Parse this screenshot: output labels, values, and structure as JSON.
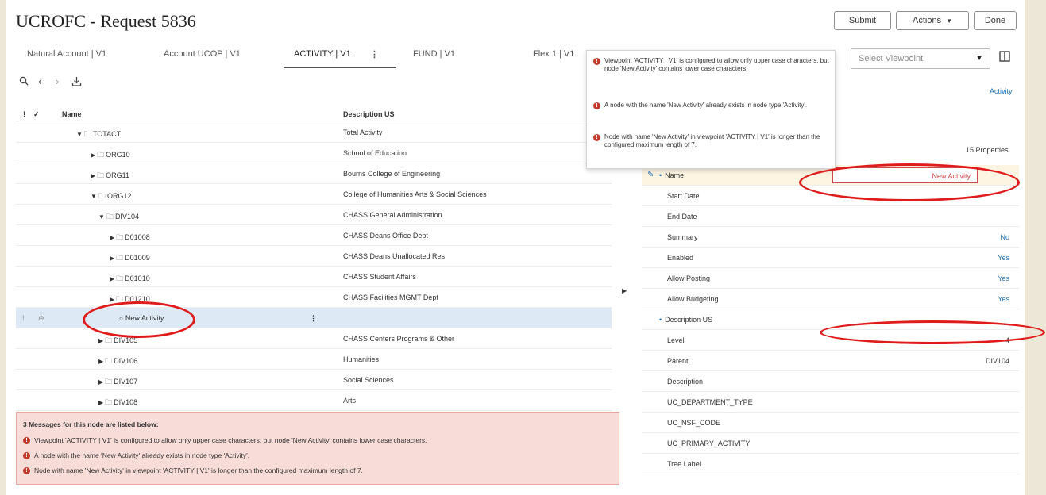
{
  "header": {
    "title": "UCROFC - Request 5836",
    "submit_label": "Submit",
    "actions_label": "Actions",
    "done_label": "Done"
  },
  "tabs": [
    {
      "label": "Natural Account | V1"
    },
    {
      "label": "Account UCOP | V1"
    },
    {
      "label": "ACTIVITY | V1"
    },
    {
      "label": "FUND | V1"
    },
    {
      "label": "Flex 1 | V1"
    }
  ],
  "tree": {
    "columns": {
      "flags": "!",
      "check": "✓",
      "name": "Name",
      "description": "Description US"
    },
    "rows": [
      {
        "name": "TOTACT",
        "description": "Total Activity"
      },
      {
        "name": "ORG10",
        "description": "School of Education"
      },
      {
        "name": "ORG11",
        "description": "Bourns College of Engineering"
      },
      {
        "name": "ORG12",
        "description": "College of Humanities Arts & Social Sciences"
      },
      {
        "name": "DIV104",
        "description": "CHASS General Administration"
      },
      {
        "name": "D01008",
        "description": "CHASS Deans Office Dept"
      },
      {
        "name": "D01009",
        "description": "CHASS Deans Unallocated Res"
      },
      {
        "name": "D01010",
        "description": "CHASS Student Affairs"
      },
      {
        "name": "D01210",
        "description": "CHASS Facilities MGMT Dept"
      },
      {
        "name": "New Activity",
        "description": "",
        "flag": "!"
      },
      {
        "name": "DIV105",
        "description": "CHASS Centers Programs & Other"
      },
      {
        "name": "DIV106",
        "description": "Humanities"
      },
      {
        "name": "DIV107",
        "description": "Social Sciences"
      },
      {
        "name": "DIV108",
        "description": "Arts"
      }
    ]
  },
  "messages": {
    "title": "3 Messages for this node are listed below:",
    "items": [
      "Viewpoint 'ACTIVITY | V1' is configured to allow only upper case characters, but node 'New Activity' contains lower case characters.",
      "A node with the name 'New Activity' already exists in node type 'Activity'.",
      "Node with name 'New Activity' in viewpoint 'ACTIVITY | V1' is longer than the configured maximum length of 7."
    ]
  },
  "tooltip": {
    "items": [
      "Viewpoint 'ACTIVITY | V1' is configured to allow only upper case characters, but node 'New Activity' contains lower case characters.",
      "A node with the name 'New Activity' already exists in node type 'Activity'.",
      "Node with name 'New Activity' in viewpoint 'ACTIVITY | V1' is longer than the configured maximum length of 7."
    ]
  },
  "viewpoint": {
    "placeholder": "Select Viewpoint"
  },
  "properties": {
    "node_type_link": "Activity",
    "count": "15 Properties",
    "name_label": "Name",
    "name_value": "New Activity",
    "rows": [
      {
        "label": "Start Date",
        "value": ""
      },
      {
        "label": "End Date",
        "value": ""
      },
      {
        "label": "Summary",
        "value": "No"
      },
      {
        "label": "Enabled",
        "value": "Yes"
      },
      {
        "label": "Allow Posting",
        "value": "Yes"
      },
      {
        "label": "Allow Budgeting",
        "value": "Yes"
      },
      {
        "label": "Description US",
        "value": ""
      },
      {
        "label": "Level",
        "value": "4"
      },
      {
        "label": "Parent",
        "value": "DIV104"
      },
      {
        "label": "Description",
        "value": ""
      },
      {
        "label": "UC_DEPARTMENT_TYPE",
        "value": ""
      },
      {
        "label": "UC_NSF_CODE",
        "value": ""
      },
      {
        "label": "UC_PRIMARY_ACTIVITY",
        "value": ""
      },
      {
        "label": "Tree Label",
        "value": ""
      }
    ]
  },
  "colors": {
    "accent": "#1f6fb2",
    "error": "#c0392b",
    "highlight": "#e01b1b"
  }
}
